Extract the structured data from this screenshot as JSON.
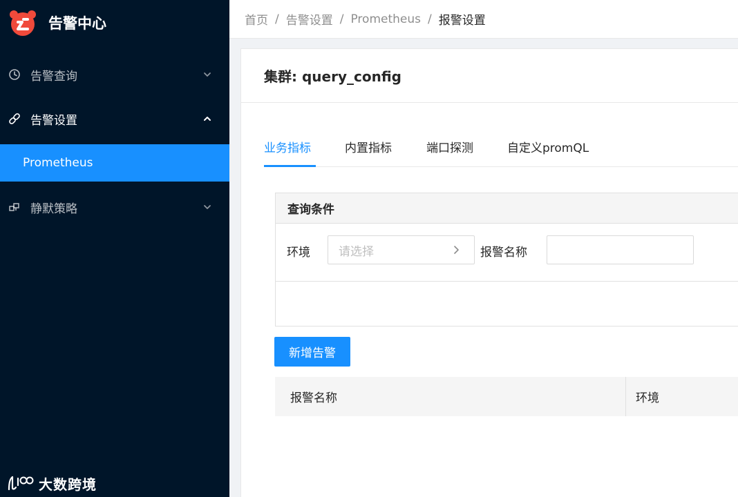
{
  "app": {
    "title": "告警中心"
  },
  "sidebar": {
    "items": [
      {
        "label": "告警查询",
        "icon": "clock-icon",
        "expanded": false
      },
      {
        "label": "告警设置",
        "icon": "link-icon",
        "expanded": true,
        "children": [
          {
            "label": "Prometheus",
            "selected": true
          }
        ]
      },
      {
        "label": "静默策略",
        "icon": "cluster-icon",
        "expanded": false
      }
    ]
  },
  "breadcrumb": [
    "首页",
    "告警设置",
    "Prometheus",
    "报警设置"
  ],
  "breadcrumb_separator": "/",
  "card": {
    "title": "集群: query_config"
  },
  "tabs": [
    {
      "label": "业务指标",
      "active": true
    },
    {
      "label": "内置指标",
      "active": false
    },
    {
      "label": "端口探测",
      "active": false
    },
    {
      "label": "自定义promQL",
      "active": false
    }
  ],
  "query": {
    "title": "查询条件",
    "env_label": "环境",
    "env_placeholder": "请选择",
    "name_label": "报警名称",
    "name_value": ""
  },
  "add_button": "新增告警",
  "table": {
    "columns": [
      "报警名称",
      "环境"
    ]
  },
  "footer": {
    "brand": "大数跨境"
  },
  "colors": {
    "sidebar_bg": "#001529",
    "accent": "#1890ff",
    "logo_red": "#f04a3b"
  }
}
